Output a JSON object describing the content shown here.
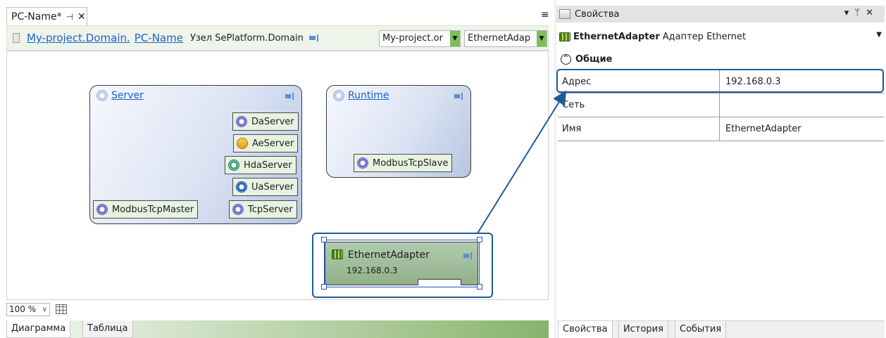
{
  "editor": {
    "tab_title": "PC-Name*",
    "breadcrumb": {
      "links": [
        "My-project.Domain.",
        "PC-Name"
      ],
      "node_label": "Узел SePlatform.Domain"
    },
    "combos": [
      "My-project.or",
      "EthernetAdap"
    ],
    "zoom": "100 %",
    "bottom_tabs": [
      "Диаграмма",
      "Таблица"
    ]
  },
  "diagram": {
    "server": {
      "title": "Server",
      "modules": [
        "DaServer",
        "AeServer",
        "HdaServer",
        "UaServer",
        "TcpServer"
      ],
      "left_module": "ModbusTcpMaster"
    },
    "runtime": {
      "title": "Runtime",
      "modules": [
        "ModbusTcpSlave"
      ]
    },
    "ethernet": {
      "title": "EthernetAdapter",
      "address": "192.168.0.3"
    }
  },
  "properties": {
    "panel_title": "Свойства",
    "object_name": "EthernetAdapter",
    "object_class": "Адаптер Ethernet",
    "category": "Общие",
    "rows": [
      {
        "key": "Адрес",
        "value": "192.168.0.3"
      },
      {
        "key": "Сеть",
        "value": ""
      },
      {
        "key": "Имя",
        "value": "EthernetAdapter"
      }
    ],
    "tabs": [
      "Свойства",
      "История",
      "События"
    ]
  },
  "colors": {
    "accent_blue": "#1e5a9a",
    "link_blue": "#1a62c9",
    "module_green": "#e8f2e0"
  }
}
